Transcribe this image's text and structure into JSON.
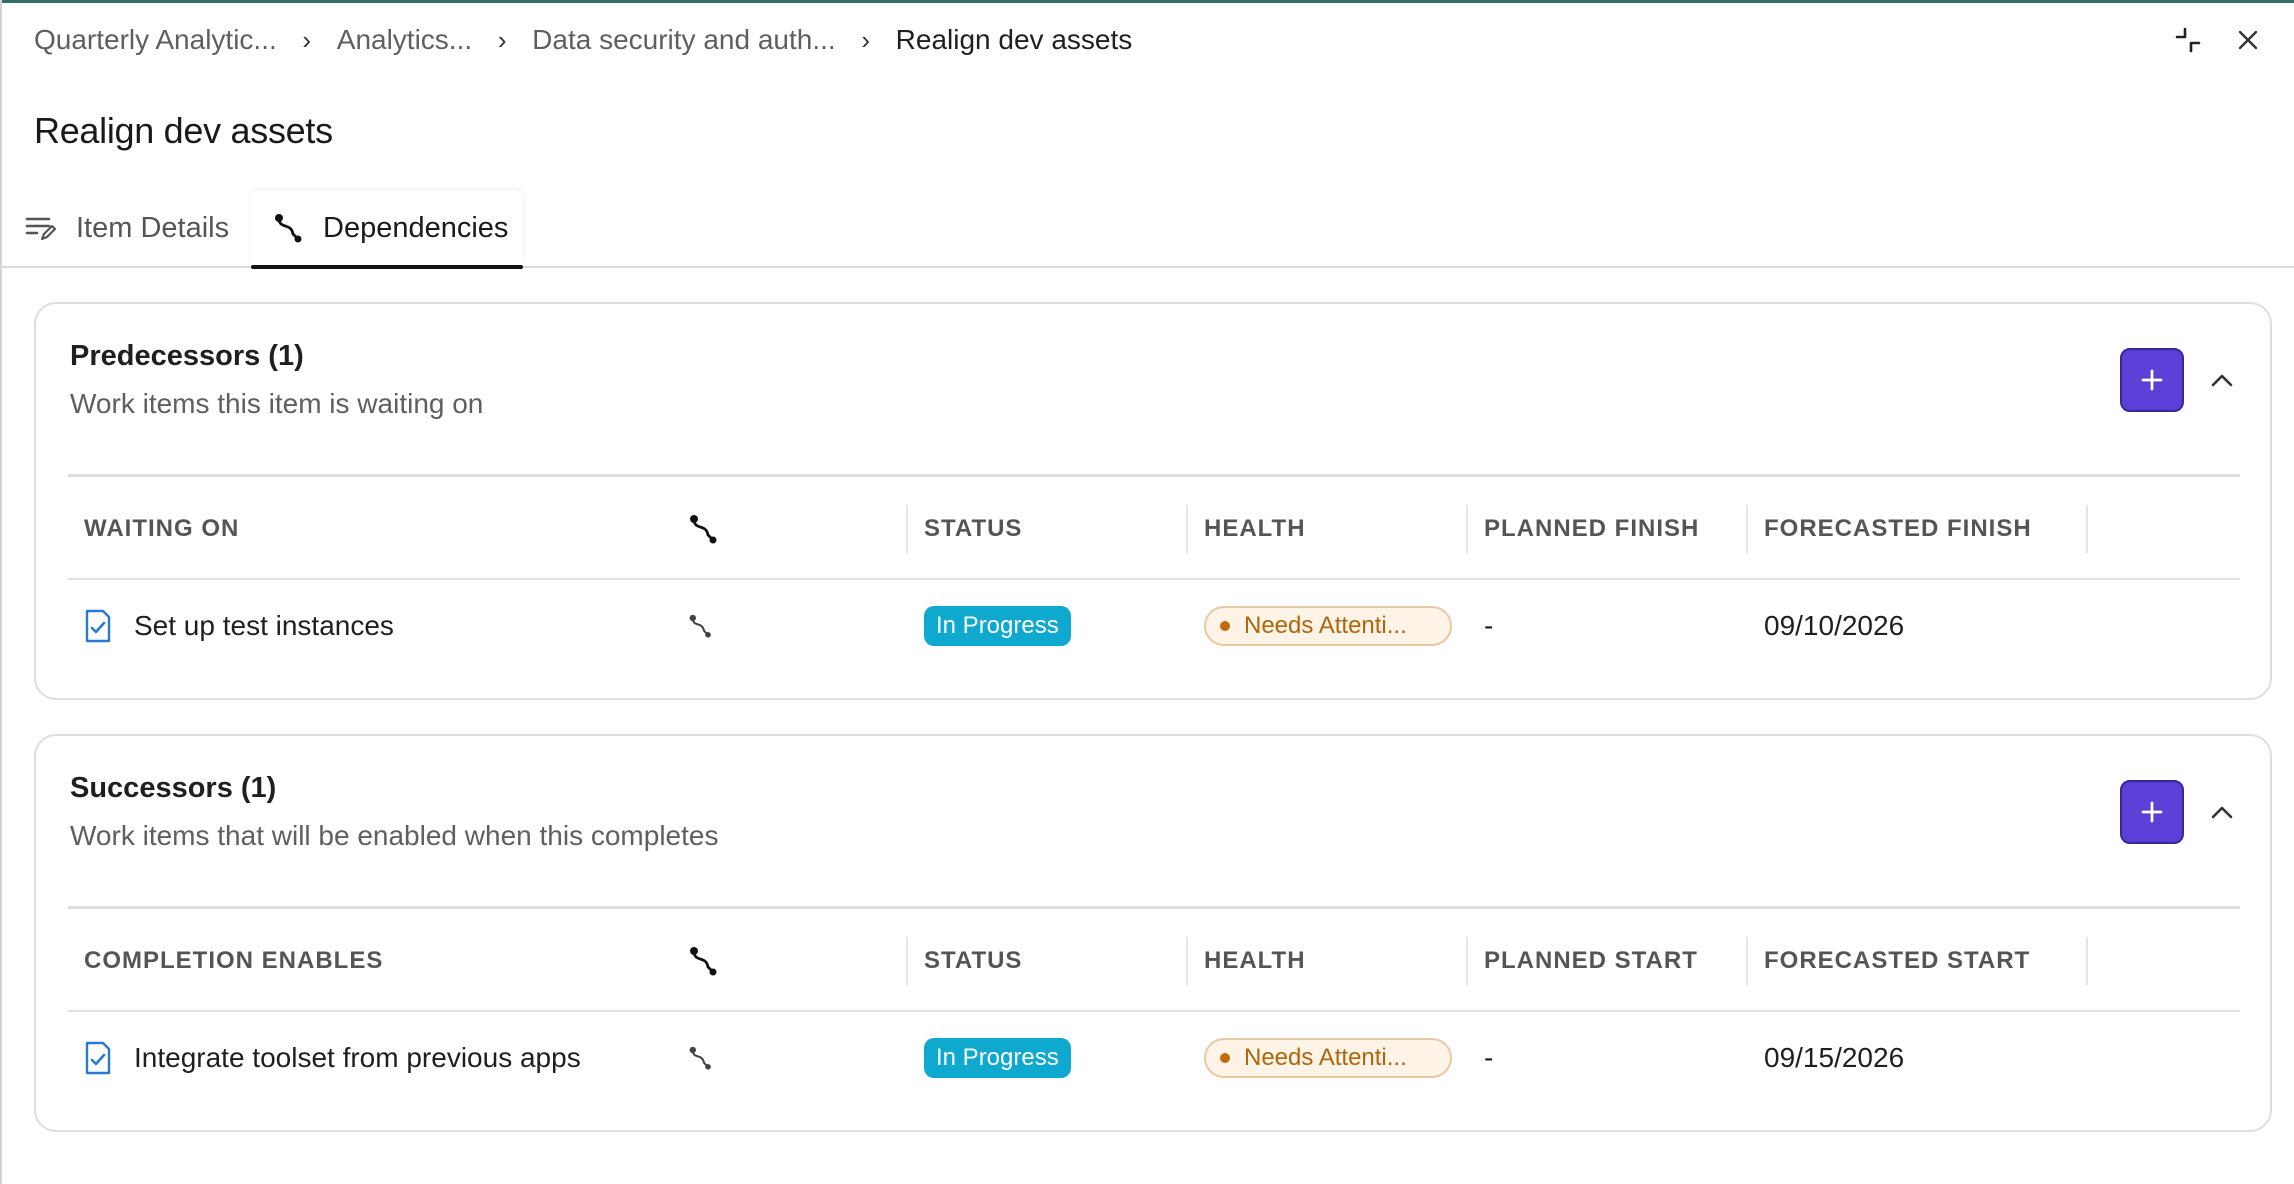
{
  "breadcrumb": [
    {
      "label": "Quarterly Analytic..."
    },
    {
      "label": "Analytics..."
    },
    {
      "label": "Data security and auth..."
    },
    {
      "label": "Realign dev assets"
    }
  ],
  "breadcrumb_separator": "›",
  "window": {
    "collapse_icon": "collapse-icon",
    "close_icon": "close-icon"
  },
  "page_title": "Realign dev assets",
  "tabs": [
    {
      "label": "Item Details",
      "icon": "edit-list-icon",
      "active": false
    },
    {
      "label": "Dependencies",
      "icon": "dependency-icon",
      "active": true
    }
  ],
  "predecessors": {
    "title": "Predecessors (1)",
    "subtitle": "Work items this item is waiting on",
    "columns": [
      "WAITING ON",
      "",
      "STATUS",
      "HEALTH",
      "PLANNED FINISH",
      "FORECASTED FINISH"
    ],
    "rows": [
      {
        "name": "Set up test instances",
        "status": "In Progress",
        "health": "Needs Attenti...",
        "planned": "-",
        "forecasted": "09/10/2026"
      }
    ]
  },
  "successors": {
    "title": "Successors (1)",
    "subtitle": "Work items that will be enabled when this completes",
    "columns": [
      "COMPLETION ENABLES",
      "",
      "STATUS",
      "HEALTH",
      "PLANNED START",
      "FORECASTED START"
    ],
    "rows": [
      {
        "name": "Integrate toolset from previous apps",
        "status": "In Progress",
        "health": "Needs Attenti...",
        "planned": "-",
        "forecasted": "09/15/2026"
      }
    ]
  },
  "colors": {
    "accent": "#5b3fd6",
    "status_in_progress": "#0fa8cf",
    "health_warning": "#b0660b",
    "top_border": "#2f6f66"
  }
}
